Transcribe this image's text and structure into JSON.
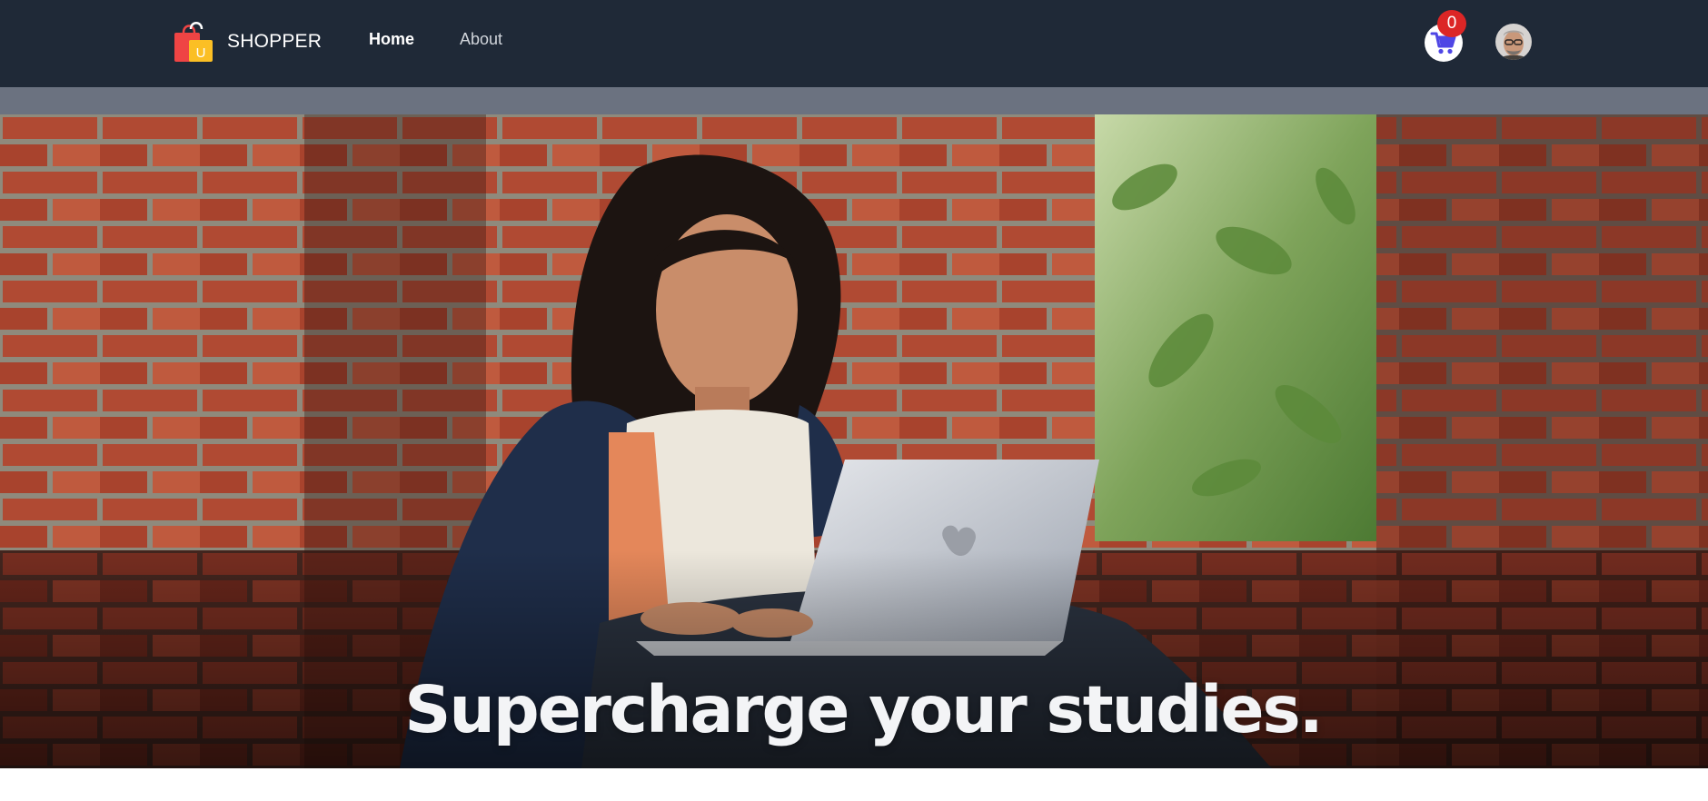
{
  "navbar": {
    "brand_name": "SHOPPER",
    "logo_icon": "shopping-bags-icon",
    "logo_letter": "U",
    "links": [
      {
        "label": "Home",
        "active": true
      },
      {
        "label": "About",
        "active": false
      }
    ],
    "cart": {
      "icon": "cart-icon",
      "count": "0"
    },
    "avatar": {
      "icon": "user-avatar"
    }
  },
  "hero": {
    "headline": "Supercharge your studies."
  },
  "colors": {
    "navbar_bg": "#1f2937",
    "strip_bg": "#6b7280",
    "badge": "#dc2626",
    "cart_icon": "#4f46e5"
  }
}
